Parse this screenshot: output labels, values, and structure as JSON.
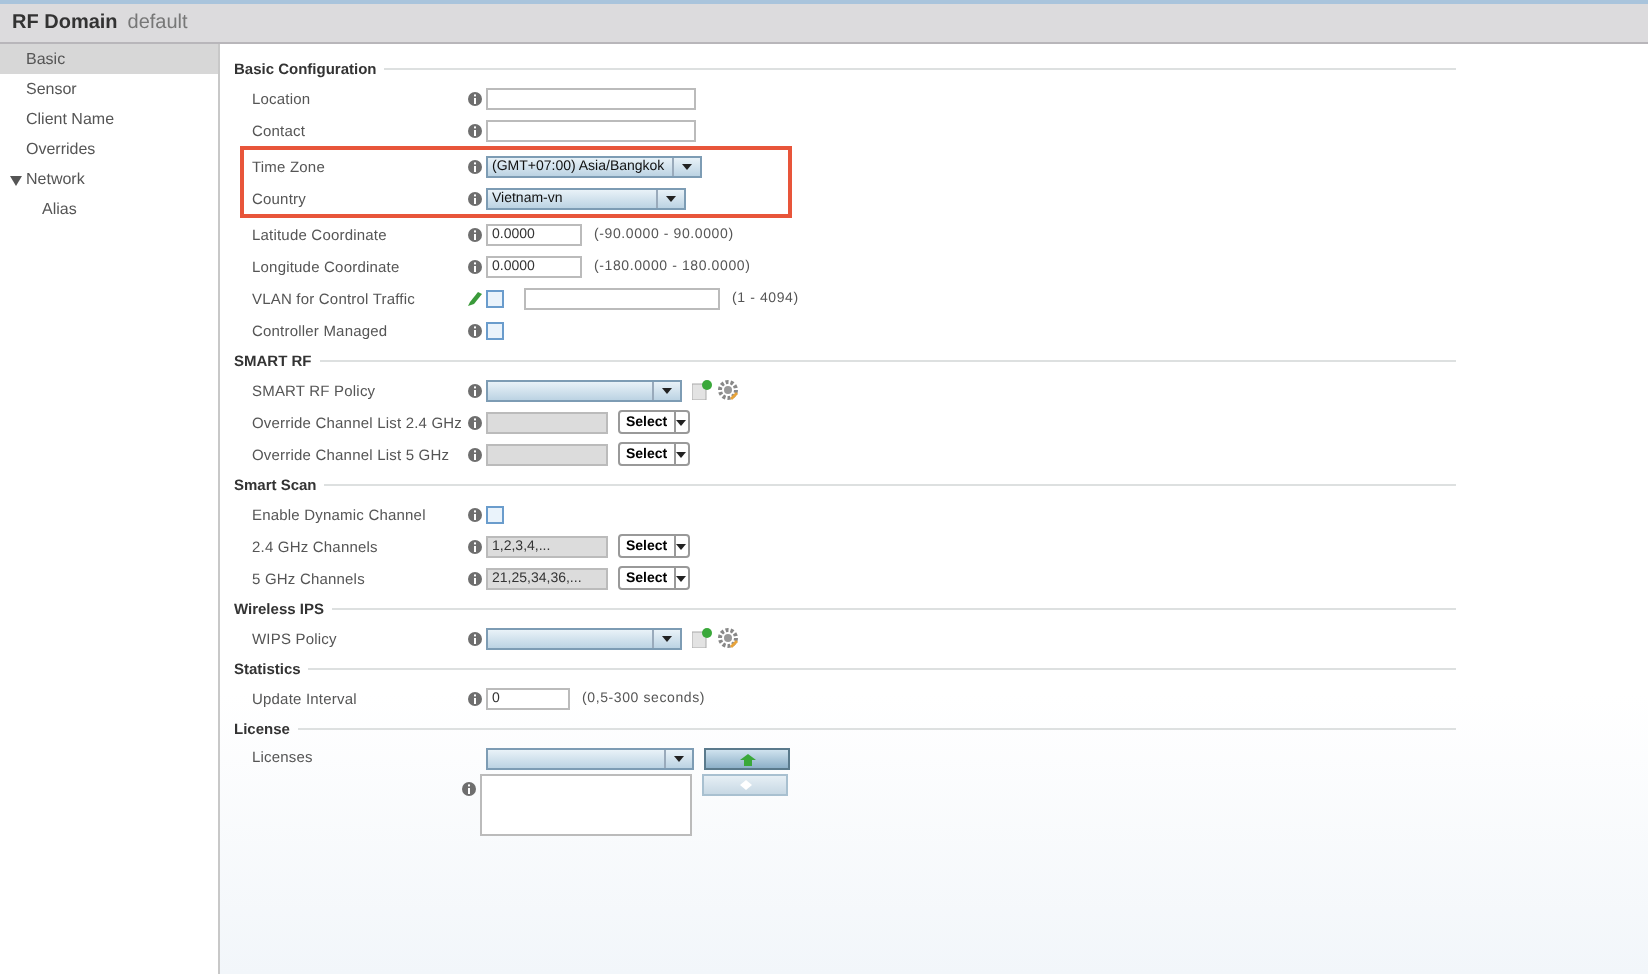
{
  "title": {
    "main": "RF Domain",
    "sub": "default"
  },
  "sidebar": [
    {
      "label": "Basic",
      "selected": true
    },
    {
      "label": "Sensor",
      "selected": false
    },
    {
      "label": "Client Name",
      "selected": false
    },
    {
      "label": "Overrides",
      "selected": false
    },
    {
      "label": "Network",
      "selected": false,
      "expanded": true,
      "children": [
        {
          "label": "Alias",
          "selected": false
        }
      ]
    }
  ],
  "sections": [
    {
      "title": "Basic Configuration",
      "rows": [
        {
          "kind": "text",
          "label": "Location",
          "highlighted": false
        },
        {
          "kind": "text",
          "label": "Contact",
          "highlighted": false
        },
        {
          "kind": "select",
          "label": "Time Zone",
          "value": "(GMT+07:00) Asia/Bangkok",
          "highlighted": true
        },
        {
          "kind": "select",
          "label": "Country",
          "value": "Vietnam-vn",
          "highlighted": true
        },
        {
          "kind": "number",
          "label": "Latitude Coordinate",
          "value": "0.0000",
          "hint": "(-90.0000 - 90.0000)",
          "highlighted": false
        },
        {
          "kind": "number",
          "label": "Longitude Coordinate",
          "value": "0.0000",
          "hint": "(-180.0000 - 180.0000)",
          "highlighted": false
        },
        {
          "kind": "vlan",
          "label": "VLAN for Control Traffic",
          "checked": false,
          "hint": "(1 - 4094)",
          "highlighted": false
        },
        {
          "kind": "checkbox",
          "label": "Controller Managed",
          "checked": false,
          "highlighted": false
        }
      ]
    },
    {
      "title": "SMART RF",
      "rows": [
        {
          "kind": "policy",
          "label": "SMART RF Policy",
          "highlighted": false
        },
        {
          "kind": "channel",
          "label": "Override Channel List 2.4 GHz",
          "button": "Select",
          "highlighted": false
        },
        {
          "kind": "channel",
          "label": "Override Channel List 5 GHz",
          "button": "Select",
          "highlighted": false
        }
      ]
    },
    {
      "title": "Smart Scan",
      "rows": [
        {
          "kind": "checkbox",
          "label": "Enable Dynamic Channel",
          "checked": false,
          "highlighted": false
        },
        {
          "kind": "channel",
          "label": "2.4 GHz Channels",
          "value": "1,2,3,4,...",
          "button": "Select",
          "highlighted": false
        },
        {
          "kind": "channel",
          "label": "5 GHz Channels",
          "value": "21,25,34,36,...",
          "button": "Select",
          "highlighted": false
        }
      ]
    },
    {
      "title": "Wireless IPS",
      "rows": [
        {
          "kind": "policy",
          "label": "WIPS Policy",
          "highlighted": false
        }
      ]
    },
    {
      "title": "Statistics",
      "rows": [
        {
          "kind": "interval",
          "label": "Update Interval",
          "value": "0",
          "hint": "(0,5-300 seconds)",
          "highlighted": false
        }
      ]
    },
    {
      "title": "License",
      "rows": [
        {
          "kind": "license",
          "label": "Licenses",
          "add_disabled": false,
          "remove_disabled": true,
          "highlighted": false
        }
      ]
    }
  ]
}
